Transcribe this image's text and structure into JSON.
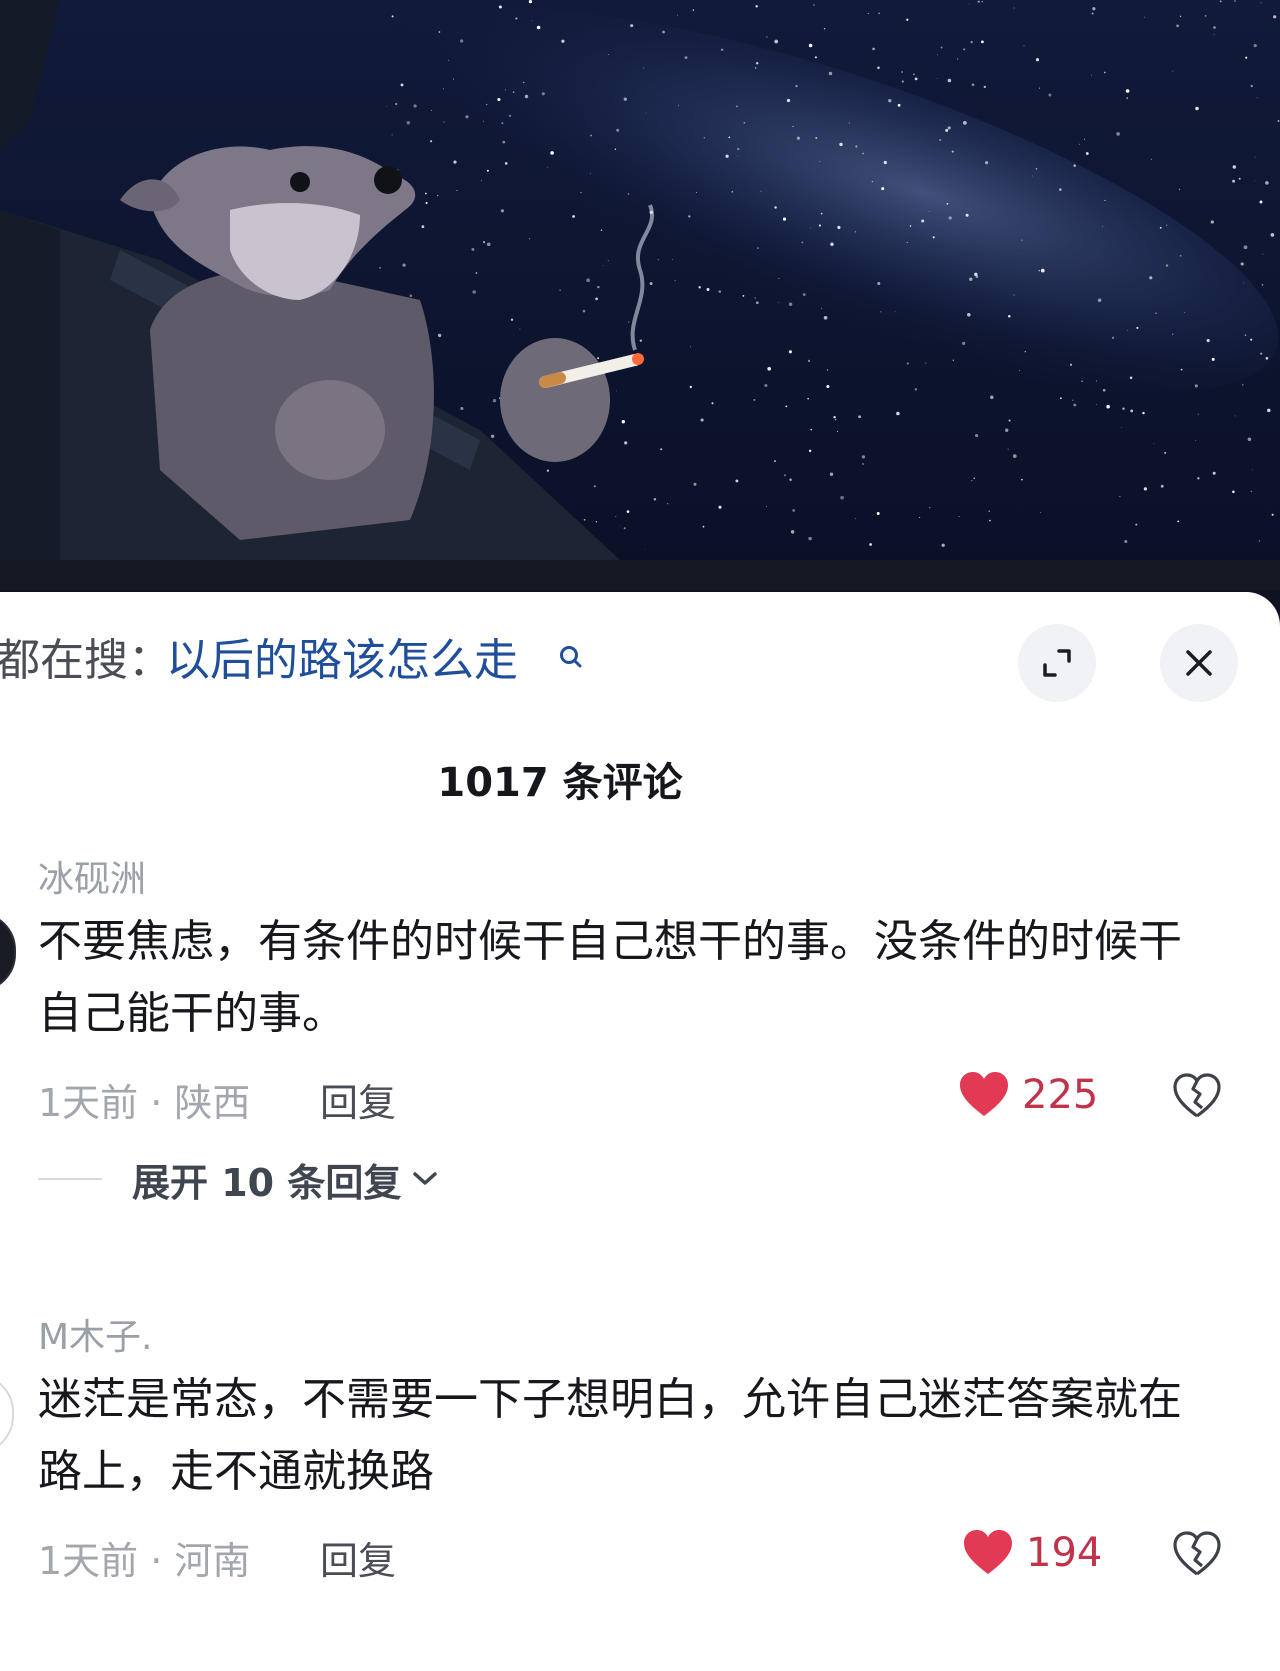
{
  "search": {
    "prefix": "都在搜：",
    "query": "以后的路该怎么走"
  },
  "header": {
    "comment_count": "1017 条评论"
  },
  "comments": [
    {
      "username": "冰砚洲",
      "text": "不要焦虑，有条件的时候干自己想干的事。没条件的时候干自己能干的事。",
      "meta": "1天前 · 陕西",
      "reply_label": "回复",
      "likes": "225",
      "expand_label": "展开 10 条回复"
    },
    {
      "username": "M木子.",
      "text": "迷茫是常态，不需要一下子想明白，允许自己迷茫答案就在路上，走不通就换路",
      "meta": "1天前 · 河南",
      "reply_label": "回复",
      "likes": "194"
    }
  ],
  "colors": {
    "link": "#1f4f9a",
    "like": "#e23a55",
    "sky": "#0d1530"
  },
  "icons": [
    "search-icon",
    "expand-icon",
    "close-icon",
    "heart-icon",
    "broken-heart-icon",
    "chevron-down-icon"
  ]
}
